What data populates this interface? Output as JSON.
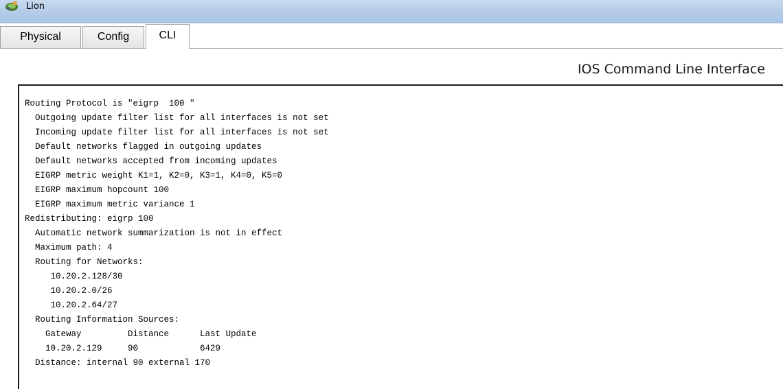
{
  "window": {
    "title": "Lion"
  },
  "tabs": [
    {
      "label": "Physical",
      "active": false
    },
    {
      "label": "Config",
      "active": false
    },
    {
      "label": "CLI",
      "active": true
    }
  ],
  "cli": {
    "heading": "IOS Command Line Interface",
    "lines": [
      "Routing Protocol is \"eigrp  100 \"",
      "  Outgoing update filter list for all interfaces is not set",
      "  Incoming update filter list for all interfaces is not set",
      "  Default networks flagged in outgoing updates",
      "  Default networks accepted from incoming updates",
      "  EIGRP metric weight K1=1, K2=0, K3=1, K4=0, K5=0",
      "  EIGRP maximum hopcount 100",
      "  EIGRP maximum metric variance 1",
      "Redistributing: eigrp 100",
      "  Automatic network summarization is not in effect",
      "  Maximum path: 4",
      "  Routing for Networks:",
      "     10.20.2.128/30",
      "     10.20.2.0/26",
      "     10.20.2.64/27",
      "  Routing Information Sources:",
      "    Gateway         Distance      Last Update",
      "    10.20.2.129     90            6429",
      "  Distance: internal 90 external 170"
    ]
  },
  "colors": {
    "titlebar": "#b7cde9",
    "terminal_text": "#000000",
    "terminal_bg": "#ffffff"
  },
  "icons": {
    "app": "packet-tracer-router-icon"
  }
}
